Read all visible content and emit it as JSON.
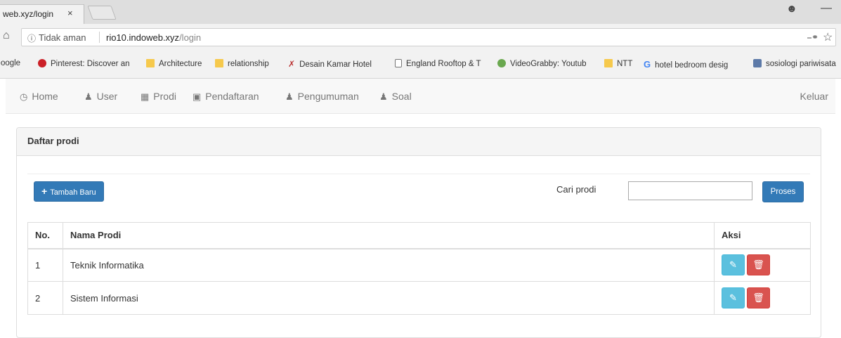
{
  "browser": {
    "tab_title": "web.xyz/login",
    "tab_close": "×",
    "security": "Tidak aman",
    "url_host": "rio10.indoweb.xyz",
    "url_path": "/login"
  },
  "bookmarks": [
    {
      "label": "Google",
      "icon": "google-icon"
    },
    {
      "label": "Pinterest: Discover an",
      "icon": "pinterest-icon"
    },
    {
      "label": "Architecture",
      "icon": "folder-icon"
    },
    {
      "label": "relationship",
      "icon": "folder-icon"
    },
    {
      "label": "Desain Kamar Hotel",
      "icon": "site-icon"
    },
    {
      "label": "England Rooftop & T",
      "icon": "page-icon"
    },
    {
      "label": "VideoGrabby: Youtub",
      "icon": "site-icon"
    },
    {
      "label": "NTT",
      "icon": "folder-icon"
    },
    {
      "label": "hotel bedroom desig",
      "icon": "google-icon"
    },
    {
      "label": "sosiologi pariwisata",
      "icon": "image-icon"
    }
  ],
  "nav": {
    "items": [
      {
        "label": "Home",
        "icon": "clock-icon"
      },
      {
        "label": "User",
        "icon": "user-icon"
      },
      {
        "label": "Prodi",
        "icon": "grid-icon"
      },
      {
        "label": "Pendaftaran",
        "icon": "picture-icon"
      },
      {
        "label": "Pengumuman",
        "icon": "user-icon"
      },
      {
        "label": "Soal",
        "icon": "user-icon"
      }
    ],
    "logout": "Keluar"
  },
  "panel": {
    "title": "Daftar prodi",
    "add_button": "Tambah Baru",
    "search_label": "Cari prodi",
    "search_value": "",
    "search_button": "Proses"
  },
  "table": {
    "headers": [
      "No.",
      "Nama Prodi",
      "Aksi"
    ],
    "rows": [
      {
        "no": "1",
        "name": "Teknik Informatika"
      },
      {
        "no": "2",
        "name": "Sistem Informasi"
      }
    ]
  },
  "colors": {
    "primary": "#337ab7",
    "info": "#5bc0de",
    "danger": "#d9534f"
  }
}
